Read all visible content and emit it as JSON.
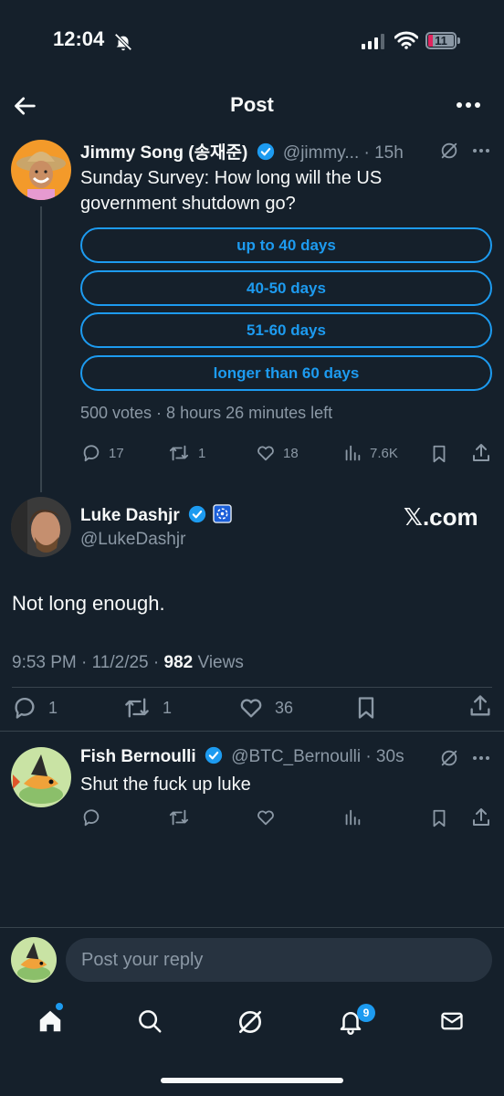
{
  "status_bar": {
    "time": "12:04",
    "battery": "11"
  },
  "header": {
    "title": "Post"
  },
  "parent_post": {
    "display_name": "Jimmy Song (송재준)",
    "handle": "@jimmy...",
    "time": "· 15h",
    "text": "Sunday Survey: How long will the US government shutdown go?",
    "poll_options": [
      "up to 40 days",
      "40-50 days",
      "51-60 days",
      "longer than 60 days"
    ],
    "poll_meta": "500 votes · 8 hours 26 minutes left",
    "replies": "17",
    "reposts": "1",
    "likes": "18",
    "views": "7.6K"
  },
  "main_post": {
    "display_name": "Luke Dashjr",
    "handle": "@LukeDashjr",
    "watermark": "𝕏.com",
    "text": "Not long enough.",
    "timestamp": "9:53 PM · 11/2/25 · ",
    "views_count": "982",
    "views_label": " Views",
    "replies": "1",
    "reposts": "1",
    "likes": "36"
  },
  "reply_post": {
    "display_name": "Fish Bernoulli",
    "handle": "@BTC_Bernoulli",
    "time": "· 30s",
    "text": "Shut the fuck up luke"
  },
  "composer": {
    "placeholder": "Post your reply"
  },
  "tab_bar": {
    "notifications_badge": "9"
  },
  "colors": {
    "background": "#15202b",
    "accent": "#1d9bf0",
    "muted": "#8b98a5",
    "text": "#f7f9f9"
  }
}
